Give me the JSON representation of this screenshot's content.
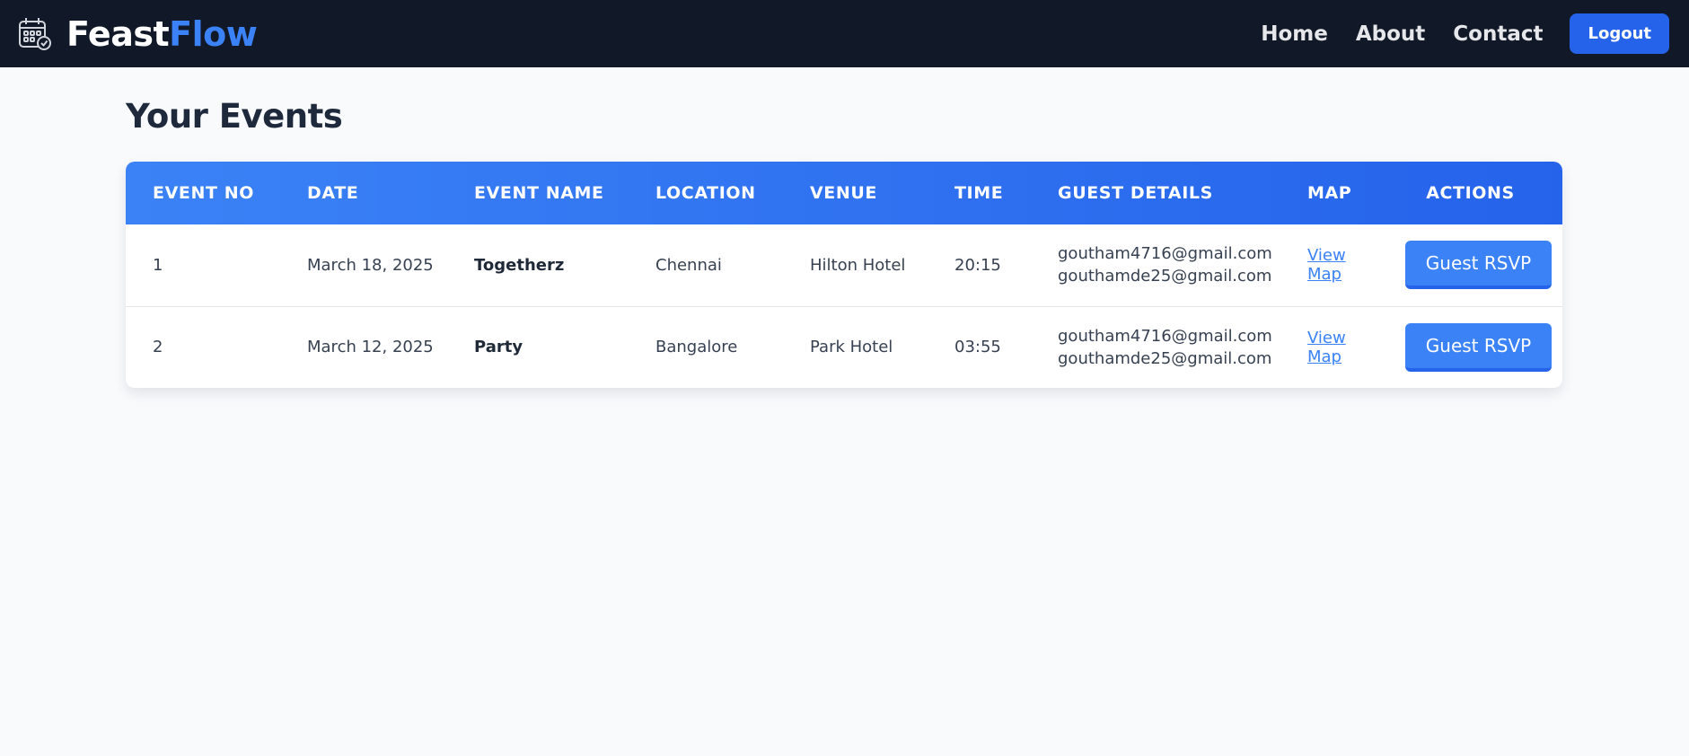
{
  "navbar": {
    "brand_part1": "Feast",
    "brand_part2": "Flow",
    "links": [
      "Home",
      "About",
      "Contact"
    ],
    "logout_label": "Logout"
  },
  "page": {
    "title": "Your Events"
  },
  "table": {
    "headers": [
      "EVENT NO",
      "DATE",
      "EVENT NAME",
      "LOCATION",
      "VENUE",
      "TIME",
      "GUEST DETAILS",
      "MAP",
      "ACTIONS"
    ],
    "rows": [
      {
        "event_no": "1",
        "date": "March 18, 2025",
        "name": "Togetherz",
        "location": "Chennai",
        "venue": "Hilton Hotel",
        "time": "20:15",
        "guests": [
          "goutham4716@gmail.com",
          "gouthamde25@gmail.com"
        ],
        "map_label": "View Map",
        "action_label": "Guest RSVP"
      },
      {
        "event_no": "2",
        "date": "March 12, 2025",
        "name": "Party",
        "location": "Bangalore",
        "venue": "Park Hotel",
        "time": "03:55",
        "guests": [
          "goutham4716@gmail.com",
          "gouthamde25@gmail.com"
        ],
        "map_label": "View Map",
        "action_label": "Guest RSVP"
      }
    ]
  },
  "colors": {
    "navbar_bg": "#111827",
    "accent": "#3b82f6",
    "accent_dark": "#2563eb",
    "page_bg": "#f8fafc"
  },
  "icons": {
    "brand": "calendar-check-icon"
  }
}
